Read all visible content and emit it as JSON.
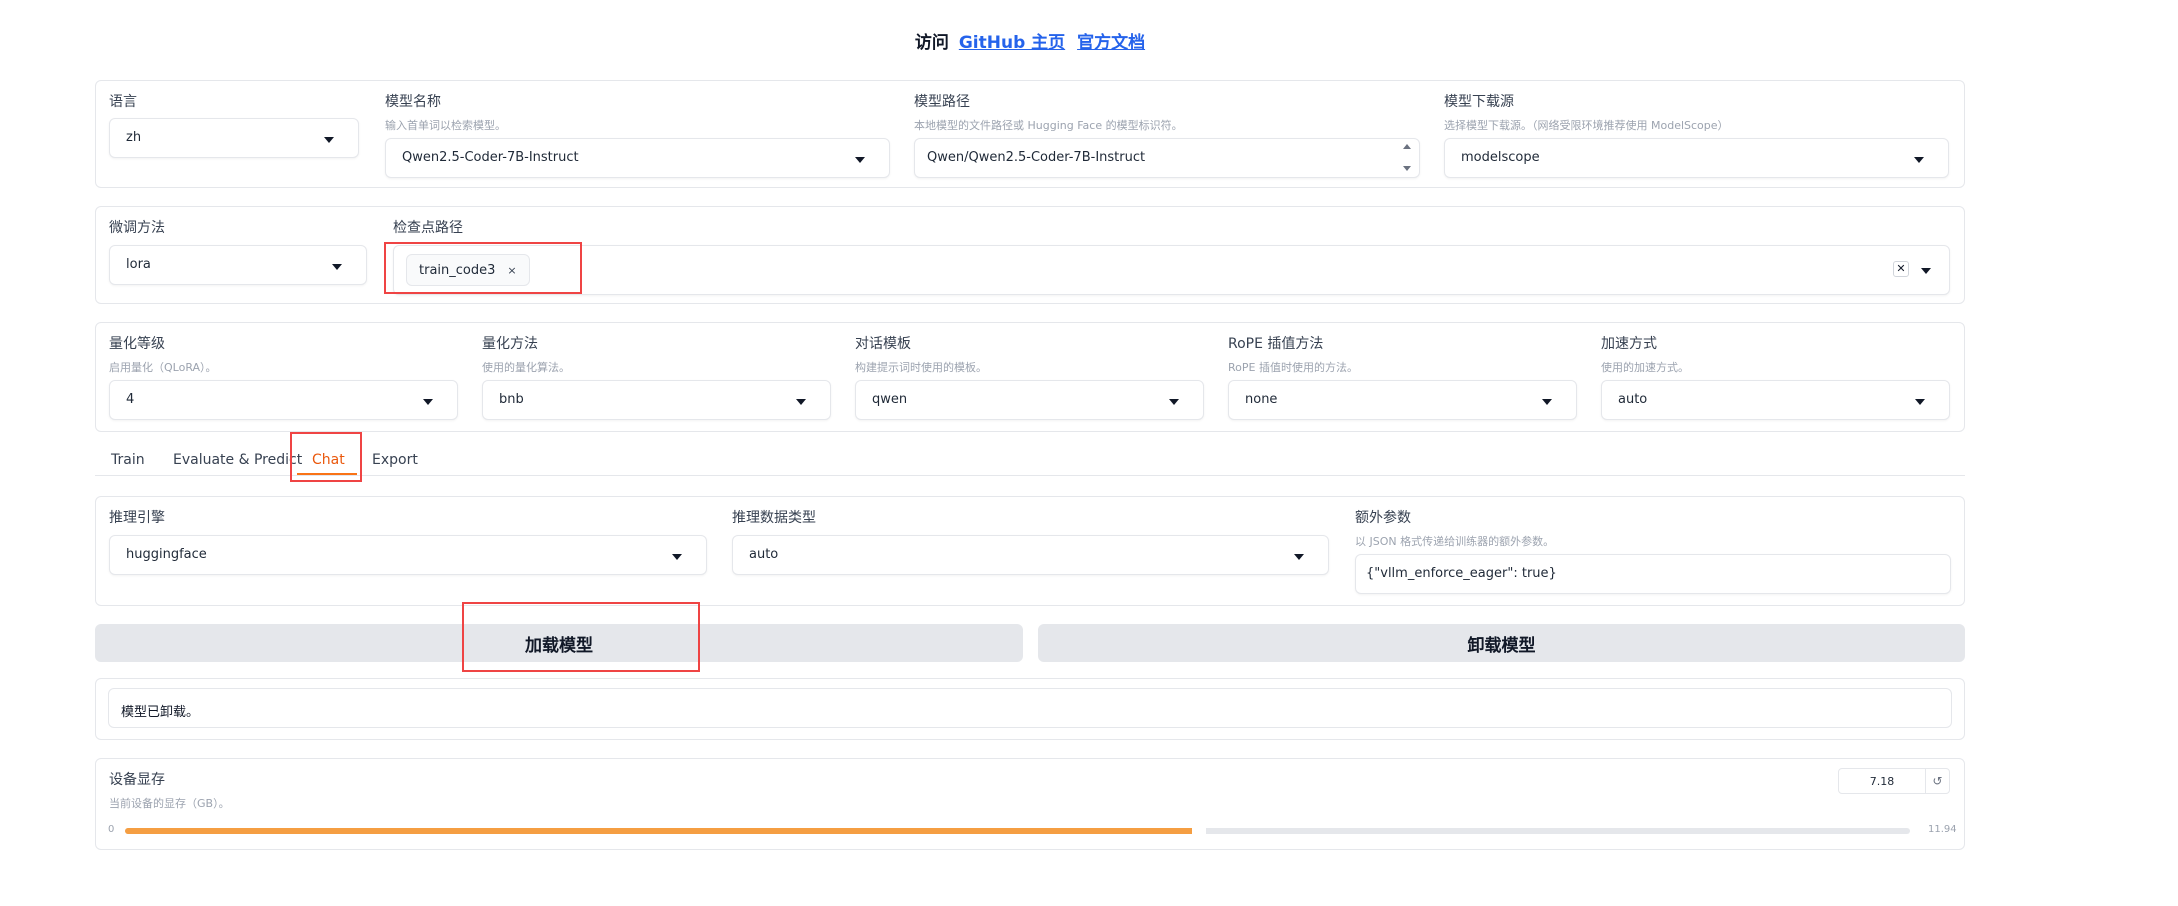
{
  "header": {
    "prefix": "访问",
    "github_link": "GitHub 主页",
    "docs_link": "官方文档"
  },
  "model_row": {
    "lang": {
      "label": "语言",
      "value": "zh"
    },
    "model_name": {
      "label": "模型名称",
      "info": "输入首单词以检索模型。",
      "value": "Qwen2.5-Coder-7B-Instruct"
    },
    "model_path": {
      "label": "模型路径",
      "info": "本地模型的文件路径或 Hugging Face 的模型标识符。",
      "value": "Qwen/Qwen2.5-Coder-7B-Instruct"
    },
    "hub": {
      "label": "模型下载源",
      "info": "选择模型下载源。（网络受限环境推荐使用 ModelScope）",
      "value": "modelscope"
    }
  },
  "finetune_row": {
    "method": {
      "label": "微调方法",
      "value": "lora"
    },
    "checkpoint": {
      "label": "检查点路径",
      "chip": "train_code3",
      "chip_remove": "×",
      "clear": "✕"
    }
  },
  "advanced_row": {
    "quant_bit": {
      "label": "量化等级",
      "info": "启用量化（QLoRA）。",
      "value": "4"
    },
    "quant_method": {
      "label": "量化方法",
      "info": "使用的量化算法。",
      "value": "bnb"
    },
    "template": {
      "label": "对话模板",
      "info": "构建提示词时使用的模板。",
      "value": "qwen"
    },
    "rope": {
      "label": "RoPE 插值方法",
      "info": "RoPE 插值时使用的方法。",
      "value": "none"
    },
    "booster": {
      "label": "加速方式",
      "info": "使用的加速方式。",
      "value": "auto"
    }
  },
  "tabs": [
    "Train",
    "Evaluate & Predict",
    "Chat",
    "Export"
  ],
  "chat_row": {
    "backend": {
      "label": "推理引擎",
      "value": "huggingface"
    },
    "dtype": {
      "label": "推理数据类型",
      "value": "auto"
    },
    "extra": {
      "label": "额外参数",
      "info": "以 JSON 格式传递给训练器的额外参数。",
      "value": "{\"vllm_enforce_eager\": true}"
    }
  },
  "buttons": {
    "load": "加载模型",
    "unload": "卸载模型"
  },
  "status": "模型已卸载。",
  "memory": {
    "label": "设备显存",
    "info": "当前设备的显存（GB）。",
    "value": "7.18",
    "min": "0",
    "max": "11.94",
    "reset_icon": "↺",
    "fill_fraction": 0.601
  },
  "colors": {
    "accent": "#f97316",
    "slider_fill": "#f59e42",
    "highlight": "#ef4444",
    "link": "#2563eb"
  }
}
